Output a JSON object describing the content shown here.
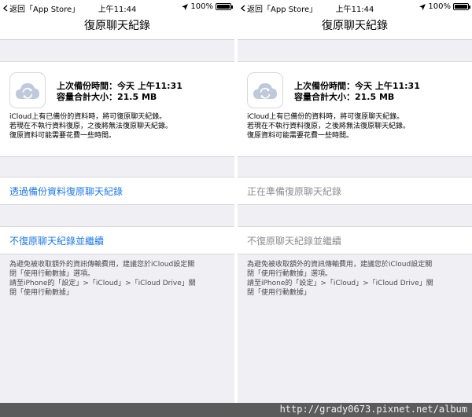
{
  "watermark": "http://grady0673.pixnet.net/album",
  "panels": [
    {
      "status": {
        "back": "返回「App Store」",
        "time": "上午11:44",
        "battery": "100%"
      },
      "title": "復原聊天紀錄",
      "backup_time": "上次備份時間：今天 上午11:31",
      "backup_size": "容量合計大小：21.5 MB",
      "desc": [
        "iCloud上有已備份的資料時，將可復原聊天紀錄。",
        "若現在不執行資料復原，之後將無法復原聊天紀錄。",
        "復原資料可能需要花費一些時間。"
      ],
      "action1": "透過備份資料復原聊天紀錄",
      "action2": "不復原聊天紀錄並繼續",
      "footnote": [
        "為避免被收取額外的資訊傳輸費用，建議您於iCloud設定關",
        "閉「使用行動數據」選項。",
        "請至iPhone的「設定」>「iCloud」>「iCloud Drive」關",
        "閉「使用行動數據」"
      ]
    },
    {
      "status": {
        "back": "返回「App Store」",
        "time": "上午11:44",
        "battery": "100%"
      },
      "title": "復原聊天紀錄",
      "backup_time": "上次備份時間：今天 上午11:31",
      "backup_size": "容量合計大小：21.5 MB",
      "desc": [
        "iCloud上有已備份的資料時，將可復原聊天紀錄。",
        "若現在不執行資料復原，之後將無法復原聊天紀錄。",
        "復原資料可能需要花費一些時間。"
      ],
      "action1": "正在準備復原聊天紀錄",
      "action2": "不復原聊天紀錄並繼續",
      "footnote": [
        "為避免被收取額外的資訊傳輸費用，建議您於iCloud設定關",
        "閉「使用行動數據」選項。",
        "請至iPhone的「設定」>「iCloud」>「iCloud Drive」關",
        "閉「使用行動數據」"
      ]
    }
  ]
}
